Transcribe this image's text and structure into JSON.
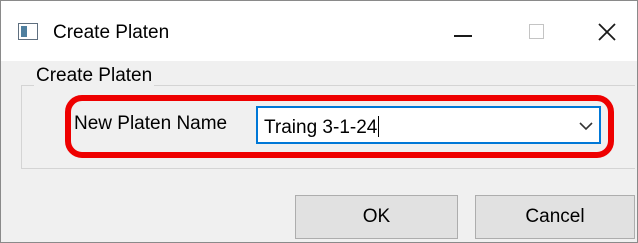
{
  "window": {
    "title": "Create Platen",
    "app_icon": "dialog-window-icon",
    "controls": {
      "minimize_icon": "minimize-icon",
      "maximize_icon": "maximize-icon",
      "close_icon": "close-icon"
    }
  },
  "group": {
    "legend": "Create Platen"
  },
  "form": {
    "label": "New Platen Name",
    "value": "Traing 3-1-24",
    "dropdown_icon": "chevron-down-icon"
  },
  "buttons": {
    "ok_label": "OK",
    "cancel_label": "Cancel"
  },
  "colors": {
    "highlight": "#ee0000",
    "focus_border": "#0078d7",
    "dialog_background": "#f0f0f0"
  }
}
